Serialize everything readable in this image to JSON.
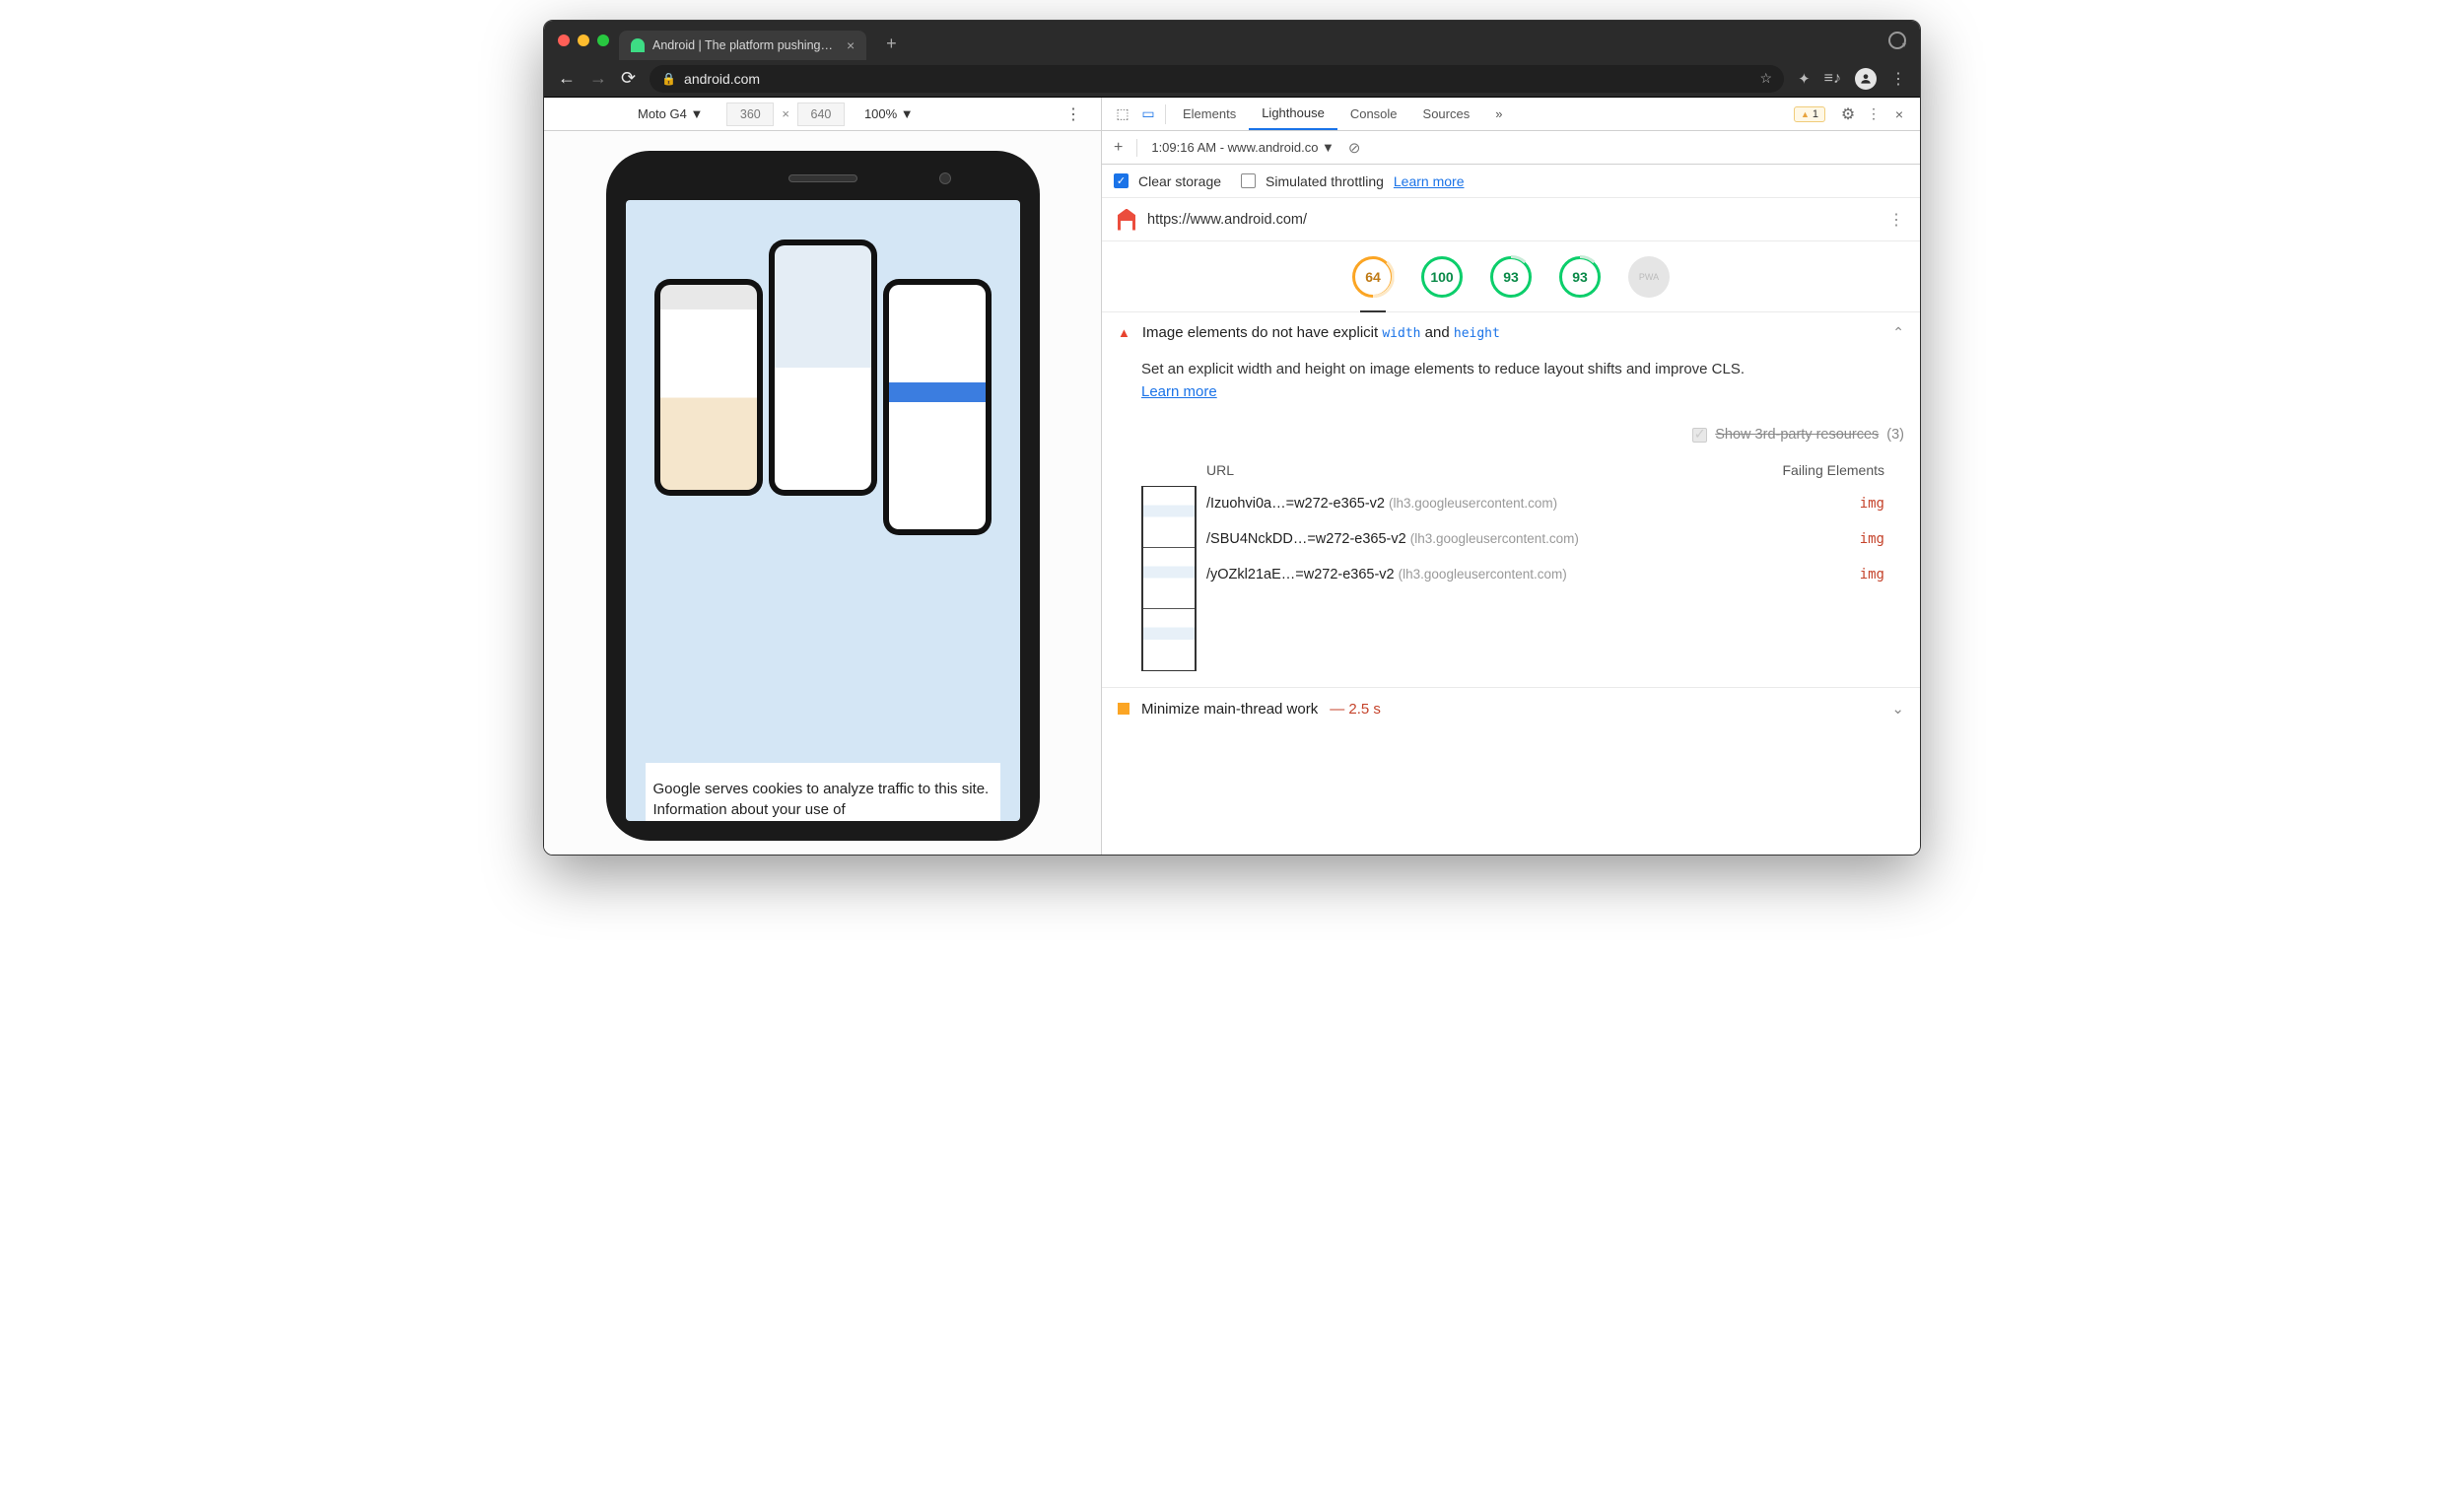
{
  "browser": {
    "tab_title": "Android | The platform pushing…",
    "url_display": "android.com"
  },
  "device_toolbar": {
    "device": "Moto G4",
    "width": "360",
    "height": "640",
    "zoom": "100%"
  },
  "page_content": {
    "cookie_text": "Google serves cookies to analyze traffic to this site. Information about your use of"
  },
  "devtools": {
    "tabs": {
      "elements": "Elements",
      "lighthouse": "Lighthouse",
      "console": "Console",
      "sources": "Sources"
    },
    "warning_count": "1",
    "subbar": {
      "report_label": "1:09:16 AM - www.android.co"
    },
    "options": {
      "clear_storage": "Clear storage",
      "simulated_throttling": "Simulated throttling",
      "learn_more": "Learn more"
    },
    "target_url": "https://www.android.com/",
    "scores": {
      "performance": "64",
      "accessibility": "100",
      "best_practices": "93",
      "seo": "93",
      "pwa": "PWA"
    },
    "audit_image": {
      "title_prefix": "Image elements do not have explicit ",
      "code1": "width",
      "mid": " and ",
      "code2": "height",
      "desc": "Set an explicit width and height on image elements to reduce layout shifts and improve CLS.",
      "learn_more": "Learn more",
      "third_party_label": "Show 3rd-party resources",
      "third_party_count": "(3)",
      "col_url": "URL",
      "col_fail": "Failing Elements",
      "rows": [
        {
          "path": "/Izuohvi0a…=w272-e365-v2",
          "domain": "(lh3.googleusercontent.com)",
          "element": "img"
        },
        {
          "path": "/SBU4NckDD…=w272-e365-v2",
          "domain": "(lh3.googleusercontent.com)",
          "element": "img"
        },
        {
          "path": "/yOZkl21aE…=w272-e365-v2",
          "domain": "(lh3.googleusercontent.com)",
          "element": "img"
        }
      ]
    },
    "audit_mainthread": {
      "title": "Minimize main-thread work",
      "value": "— 2.5 s"
    }
  }
}
